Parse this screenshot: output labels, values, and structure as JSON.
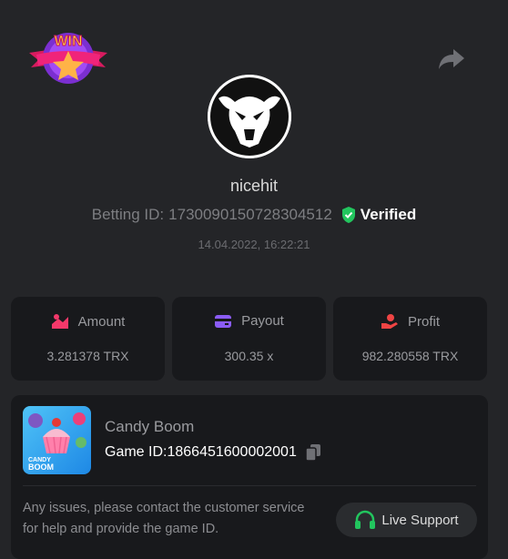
{
  "badge": {
    "text": "WIN"
  },
  "user": {
    "username": "nicehit",
    "betting_id_label": "Betting ID:",
    "betting_id": "1730090150728304512",
    "verified_label": "Verified",
    "date": "14.04.2022, 16:22:21"
  },
  "stats": {
    "amount_label": "Amount",
    "amount_value": "3.281378 TRX",
    "payout_label": "Payout",
    "payout_value": "300.35 x",
    "profit_label": "Profit",
    "profit_value": "982.280558 TRX"
  },
  "game": {
    "name": "Candy Boom",
    "id_label": "Game ID:",
    "id": "1866451600002001",
    "thumb_brand": "CANDY",
    "thumb_title": "BOOM"
  },
  "support": {
    "notice": "Any issues, please contact the customer service for help and provide the game ID.",
    "button_label": "Live Support"
  },
  "colors": {
    "background": "#242528",
    "card": "#18191c",
    "verified_green": "#22c55e",
    "amount_icon": "#f2386a",
    "payout_icon": "#8b5cf6",
    "profit_icon": "#ef4444"
  }
}
